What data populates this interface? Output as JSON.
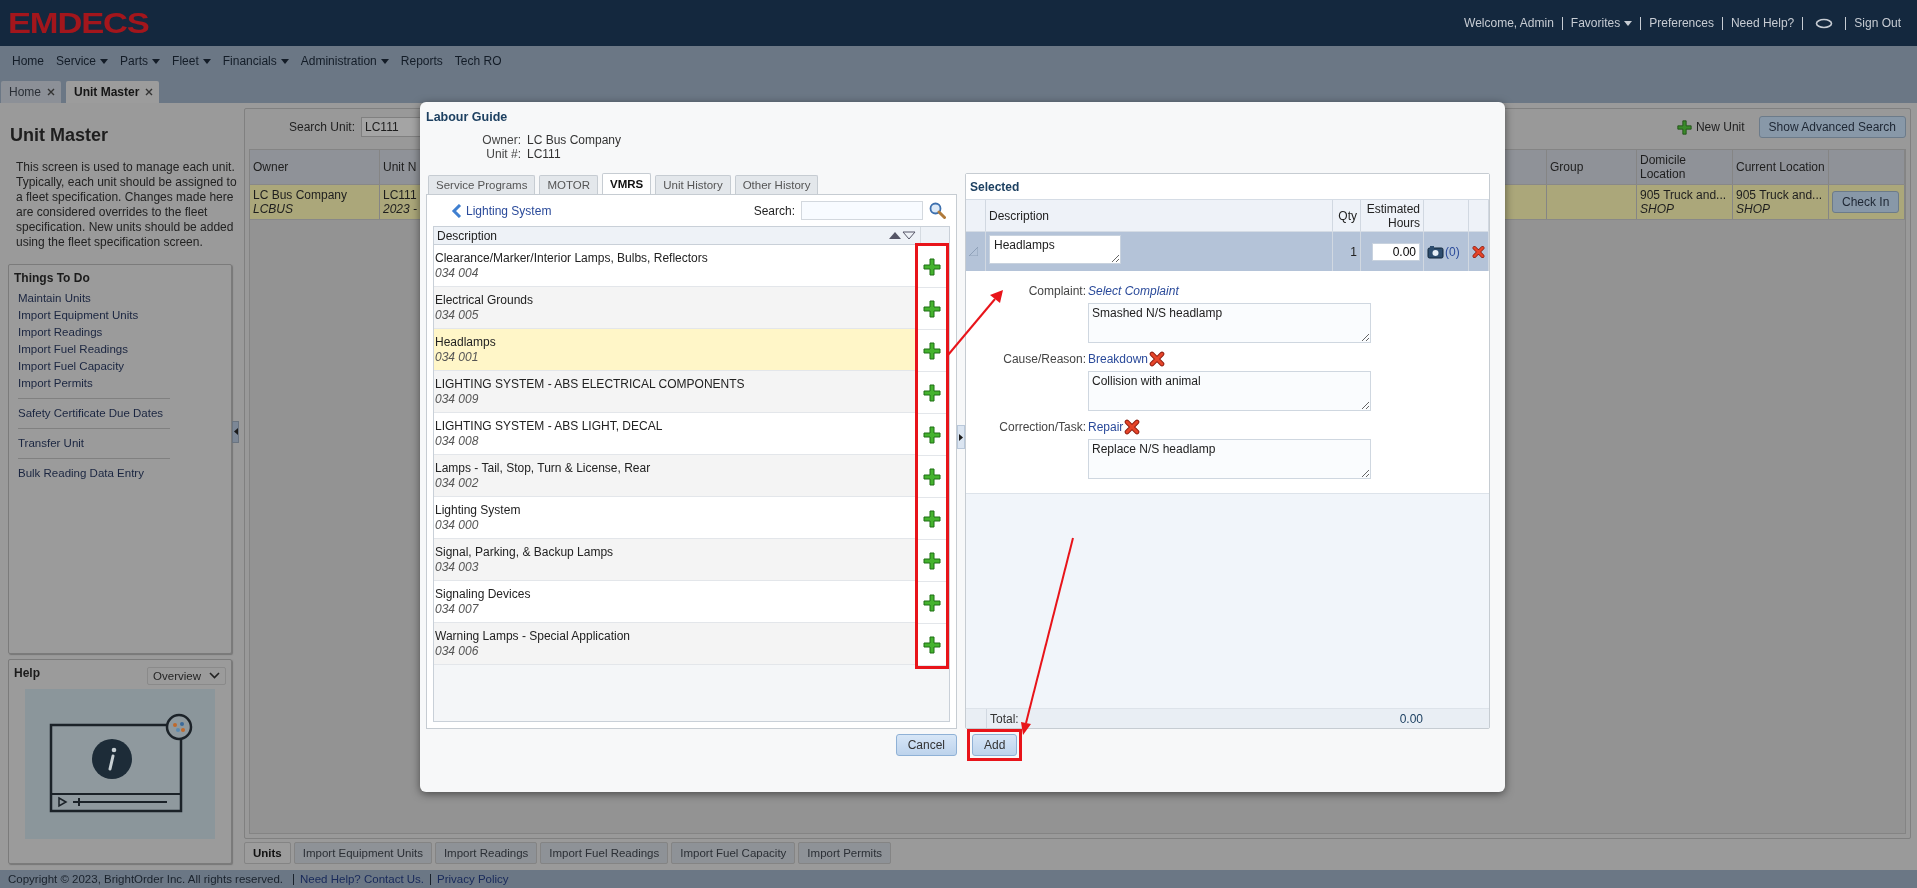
{
  "header": {
    "logo": "EMDECS",
    "welcome": "Welcome, Admin",
    "favorites": "Favorites",
    "preferences": "Preferences",
    "help": "Need Help?",
    "sign_out": "Sign Out"
  },
  "nav": [
    {
      "label": "Home",
      "dropdown": false
    },
    {
      "label": "Service",
      "dropdown": true
    },
    {
      "label": "Parts",
      "dropdown": true
    },
    {
      "label": "Fleet",
      "dropdown": true
    },
    {
      "label": "Financials",
      "dropdown": true
    },
    {
      "label": "Administration",
      "dropdown": true
    },
    {
      "label": "Reports",
      "dropdown": false
    },
    {
      "label": "Tech RO",
      "dropdown": false
    }
  ],
  "page_tabs": [
    {
      "label": "Home",
      "selected": false
    },
    {
      "label": "Unit Master",
      "selected": true
    }
  ],
  "sidebar": {
    "title": "Unit Master",
    "description": "This screen is used to manage each unit. Typically, each unit should be assigned to a fleet specification. Changes made here are considered overrides to the fleet specification. New units should be added using the fleet specification screen.",
    "things_to_do": {
      "title": "Things To Do",
      "groups": [
        {
          "links": [
            "Maintain Units",
            "Import Equipment Units",
            "Import Readings",
            "Import Fuel Readings",
            "Import Fuel Capacity",
            "Import Permits"
          ]
        },
        {
          "links": [
            "Safety Certificate Due Dates"
          ]
        },
        {
          "links": [
            "Transfer Unit"
          ]
        },
        {
          "links": [
            "Bulk Reading Data Entry"
          ]
        }
      ]
    },
    "help": {
      "title": "Help",
      "select": "Overview"
    }
  },
  "search": {
    "label": "Search Unit:",
    "value": "LC111"
  },
  "new_unit": "New Unit",
  "advanced_search": "Show Advanced Search",
  "units_table": {
    "columns": [
      "Owner",
      "Unit N",
      "Group",
      "Domicile Location",
      "Current Location"
    ],
    "rows": [
      {
        "selected": true,
        "cells": [
          {
            "main": "LC Bus Company",
            "sub": "LCBUS"
          },
          {
            "main": "LC111",
            "sub": "2023 -"
          },
          {},
          {
            "main": "905 Truck and...",
            "sub": "SHOP"
          },
          {
            "main": "905 Truck and...",
            "sub": "SHOP"
          }
        ],
        "action": "Check In"
      }
    ]
  },
  "bottom_tabs": [
    {
      "label": "Units",
      "selected": true
    },
    {
      "label": "Import Equipment Units",
      "selected": false
    },
    {
      "label": "Import Readings",
      "selected": false
    },
    {
      "label": "Import Fuel Readings",
      "selected": false
    },
    {
      "label": "Import Fuel Capacity",
      "selected": false
    },
    {
      "label": "Import Permits",
      "selected": false
    }
  ],
  "footer": {
    "copyright": "Copyright © 2023, BrightOrder Inc. All rights reserved.",
    "links": [
      "Need Help? Contact Us.",
      "Privacy Policy"
    ]
  },
  "modal": {
    "title": "Labour Guide",
    "owner_label": "Owner:",
    "owner": "LC Bus Company",
    "unit_label": "Unit #:",
    "unit": "LC111",
    "tabs": [
      {
        "label": "Service Programs",
        "selected": false
      },
      {
        "label": "MOTOR",
        "selected": false
      },
      {
        "label": "VMRS",
        "selected": true
      },
      {
        "label": "Unit History",
        "selected": false
      },
      {
        "label": "Other History",
        "selected": false
      }
    ],
    "breadcrumb": "Lighting System",
    "search_label": "Search:",
    "list_header": "Description",
    "items": [
      {
        "name": "Clearance/Marker/Interior Lamps, Bulbs, Reflectors",
        "code": "034 004",
        "selected": false
      },
      {
        "name": "Electrical Grounds",
        "code": "034 005",
        "selected": false
      },
      {
        "name": "Headlamps",
        "code": "034 001",
        "selected": true
      },
      {
        "name": "LIGHTING SYSTEM - ABS ELECTRICAL COMPONENTS",
        "code": "034 009",
        "selected": false
      },
      {
        "name": "LIGHTING SYSTEM - ABS LIGHT, DECAL",
        "code": "034 008",
        "selected": false
      },
      {
        "name": "Lamps - Tail, Stop, Turn & License, Rear",
        "code": "034 002",
        "selected": false
      },
      {
        "name": "Lighting System",
        "code": "034 000",
        "selected": false
      },
      {
        "name": "Signal, Parking, & Backup Lamps",
        "code": "034 003",
        "selected": false
      },
      {
        "name": "Signaling Devices",
        "code": "034 007",
        "selected": false
      },
      {
        "name": "Warning Lamps - Special Application",
        "code": "034 006",
        "selected": false
      }
    ],
    "cancel": "Cancel",
    "selected": {
      "title": "Selected",
      "columns": [
        "Description",
        "Qty",
        "Estimated Hours"
      ],
      "row": {
        "description": "Headlamps",
        "qty": "1",
        "hours": "0.00",
        "photos": "(0)"
      },
      "fields": [
        {
          "label": "Complaint:",
          "link": "Select Complaint",
          "set": false,
          "text": "Smashed N/S headlamp"
        },
        {
          "label": "Cause/Reason:",
          "link": "Breakdown",
          "set": true,
          "text": "Collision with animal"
        },
        {
          "label": "Correction/Task:",
          "link": "Repair",
          "set": true,
          "text": "Replace N/S headlamp"
        }
      ],
      "total_label": "Total:",
      "total": "0.00"
    },
    "add": "Add"
  }
}
